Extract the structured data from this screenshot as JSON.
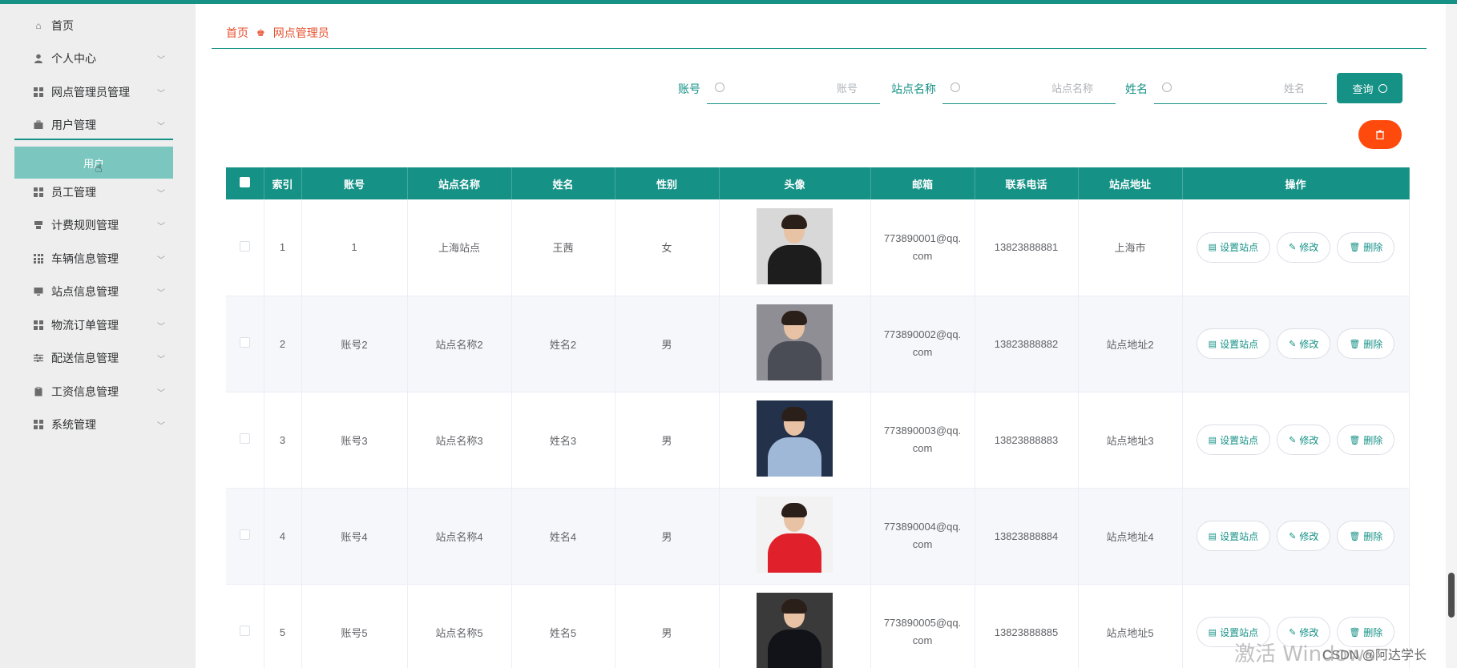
{
  "sidebar": {
    "items": [
      {
        "label": "首页",
        "icon": "home-icon",
        "has_chevron": false
      },
      {
        "label": "个人中心",
        "icon": "user-icon",
        "has_chevron": true
      },
      {
        "label": "网点管理员管理",
        "icon": "grid-icon",
        "has_chevron": true
      },
      {
        "label": "用户管理",
        "icon": "briefcase-icon",
        "has_chevron": true
      },
      {
        "label": "员工管理",
        "icon": "grid-icon",
        "has_chevron": true
      },
      {
        "label": "计费规则管理",
        "icon": "receipt-icon",
        "has_chevron": true
      },
      {
        "label": "车辆信息管理",
        "icon": "grid-icon",
        "has_chevron": true
      },
      {
        "label": "站点信息管理",
        "icon": "monitor-icon",
        "has_chevron": true
      },
      {
        "label": "物流订单管理",
        "icon": "grid-icon",
        "has_chevron": true
      },
      {
        "label": "配送信息管理",
        "icon": "sliders-icon",
        "has_chevron": true
      },
      {
        "label": "工资信息管理",
        "icon": "clipboard-icon",
        "has_chevron": true
      },
      {
        "label": "系统管理",
        "icon": "grid-icon",
        "has_chevron": true
      }
    ],
    "submenu_active": "用户"
  },
  "breadcrumb": {
    "home": "首页",
    "current": "网点管理员"
  },
  "search": {
    "account_label": "账号",
    "account_placeholder": "账号",
    "station_label": "站点名称",
    "station_placeholder": "站点名称",
    "name_label": "姓名",
    "name_placeholder": "姓名",
    "query_button": "查询"
  },
  "table": {
    "headers": [
      "",
      "索引",
      "账号",
      "站点名称",
      "姓名",
      "性别",
      "头像",
      "邮箱",
      "联系电话",
      "站点地址",
      "操作"
    ],
    "rows": [
      {
        "index": "1",
        "account": "1",
        "station": "上海站点",
        "name": "王茜",
        "gender": "女",
        "email_1": "773890001@qq.",
        "email_2": "com",
        "phone": "13823888881",
        "address": "上海市"
      },
      {
        "index": "2",
        "account": "账号2",
        "station": "站点名称2",
        "name": "姓名2",
        "gender": "男",
        "email_1": "773890002@qq.",
        "email_2": "com",
        "phone": "13823888882",
        "address": "站点地址2"
      },
      {
        "index": "3",
        "account": "账号3",
        "station": "站点名称3",
        "name": "姓名3",
        "gender": "男",
        "email_1": "773890003@qq.",
        "email_2": "com",
        "phone": "13823888883",
        "address": "站点地址3"
      },
      {
        "index": "4",
        "account": "账号4",
        "station": "站点名称4",
        "name": "姓名4",
        "gender": "男",
        "email_1": "773890004@qq.",
        "email_2": "com",
        "phone": "13823888884",
        "address": "站点地址4"
      },
      {
        "index": "5",
        "account": "账号5",
        "station": "站点名称5",
        "name": "姓名5",
        "gender": "男",
        "email_1": "773890005@qq.",
        "email_2": "com",
        "phone": "13823888885",
        "address": "站点地址5"
      }
    ],
    "actions": {
      "set_station": "设置站点",
      "edit": "修改",
      "delete": "删除"
    }
  },
  "watermark": "激活 Windows",
  "credit": "CSDN @阿达学长",
  "colors": {
    "primary": "#159186",
    "danger": "#ff4a0d",
    "breadcrumb": "#e6512f",
    "submenu_active_bg": "#7bc7bf"
  }
}
